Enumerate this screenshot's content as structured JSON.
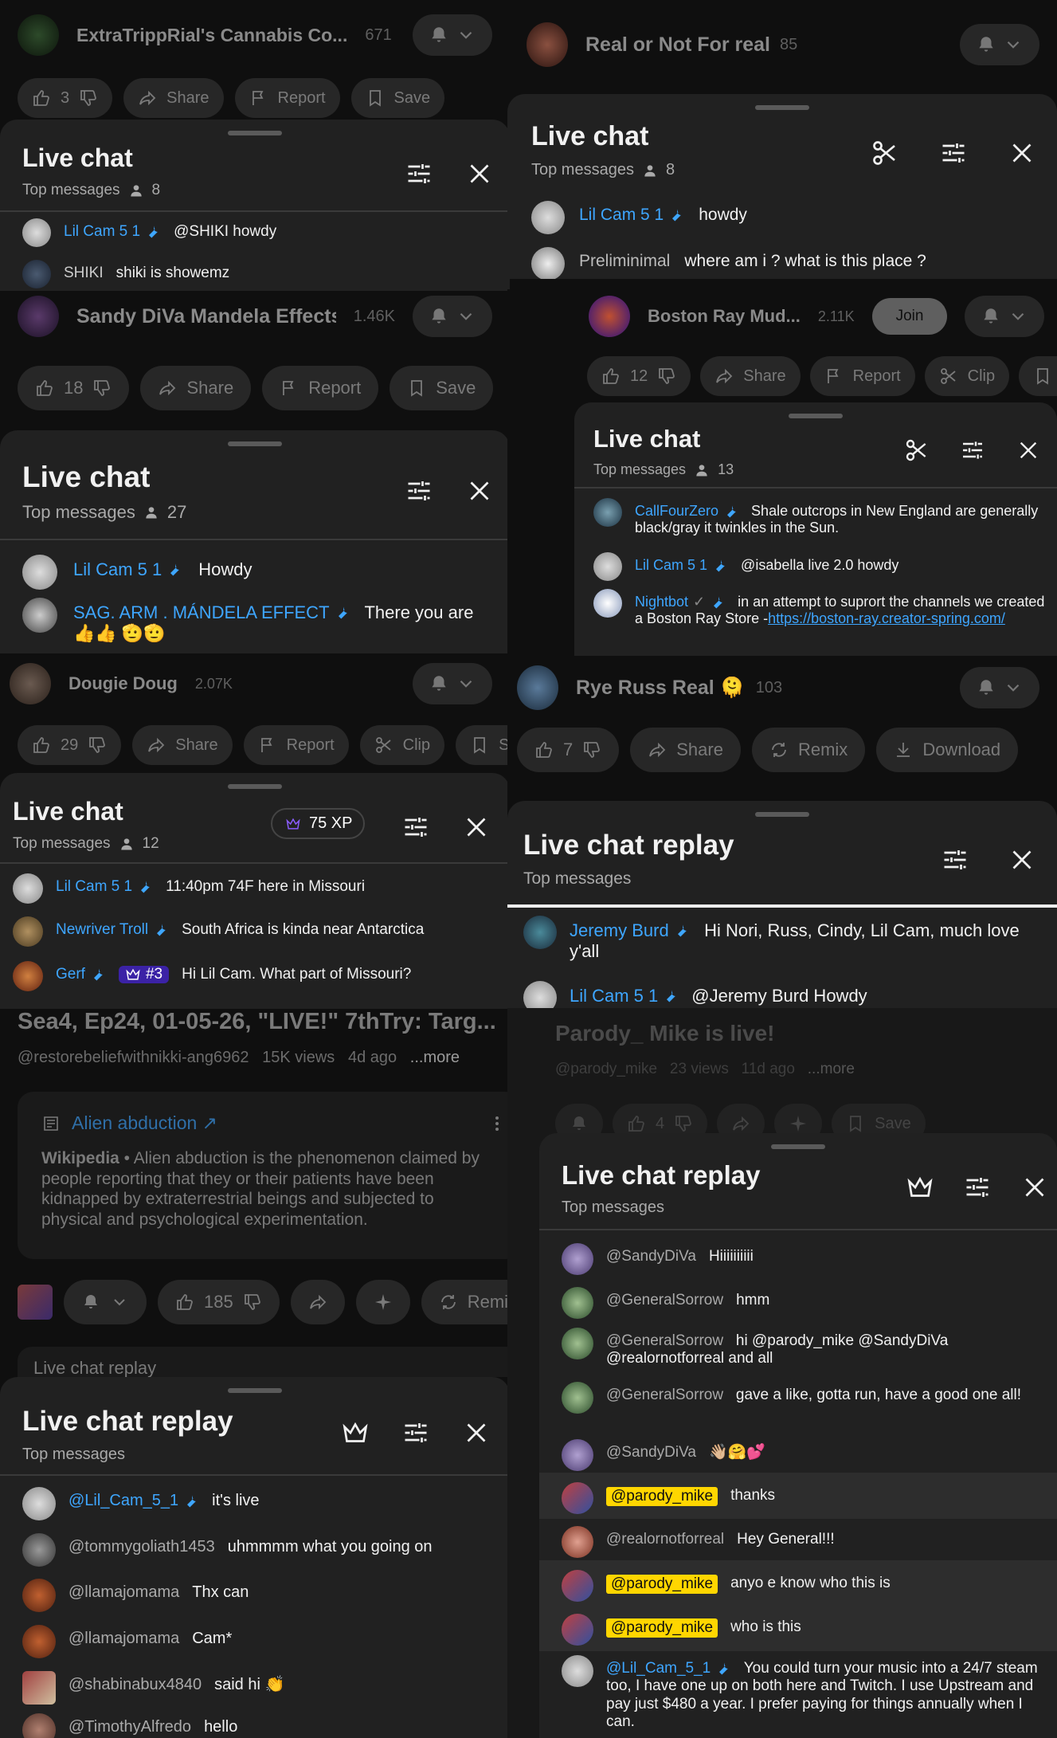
{
  "left": {
    "s1": {
      "channel": "ExtraTrippRial's Cannabis Co...",
      "count": "671",
      "likes": "3",
      "share": "Share",
      "report": "Report",
      "save": "Save",
      "chat": {
        "title": "Live chat",
        "subtitle": "Top messages",
        "viewers": "8",
        "messages": [
          {
            "author": "Lil Cam 5 1",
            "text": "@SHIKI howdy",
            "mod": true
          },
          {
            "author": "SHIKI",
            "text": "shiki is showemz",
            "mod": false
          }
        ]
      }
    },
    "s2": {
      "channel": "Sandy DiVa Mandela Effects",
      "count": "1.46K",
      "likes": "18",
      "share": "Share",
      "report": "Report",
      "save": "Save",
      "chat": {
        "title": "Live chat",
        "subtitle": "Top messages",
        "viewers": "27",
        "messages": [
          {
            "author": "Lil Cam 5 1",
            "text": "Howdy"
          },
          {
            "author": "SAG. ARM . MÁNDELA EFFECT",
            "text": "There you are 👍👍 🫡🫡"
          }
        ]
      }
    },
    "s3": {
      "channel": "Dougie Doug",
      "count": "2.07K",
      "likes": "29",
      "share": "Share",
      "report": "Report",
      "clip": "Clip",
      "save": "Sa",
      "chat": {
        "title": "Live chat",
        "subtitle": "Top messages",
        "viewers": "12",
        "xp": "75 XP",
        "messages": [
          {
            "author": "Lil Cam 5 1",
            "text": "11:40pm 74F here in Missouri"
          },
          {
            "author": "Newriver Troll",
            "text": "South Africa is kinda near Antarctica"
          },
          {
            "author": "Gerf",
            "badge": "#3",
            "text": "Hi Lil Cam. What part of Missouri?"
          }
        ]
      },
      "video_title": "Sea4, Ep24, 01-05-26, \"LIVE!\" 7thTry: Targ...",
      "video_meta": "@restorebeliefwithnikki-ang6962   15K views   4d ago",
      "more": "...more",
      "card": {
        "link": "Alien abduction ↗",
        "source": "Wikipedia",
        "text": " • Alien abduction is the phenomenon claimed by people reporting that they or their patients have been kidnapped by extraterrestrial beings and subjected to physical and psychological experimentation."
      },
      "likes2": "185",
      "remix": "Remix",
      "replay_peek": "Live chat replay"
    },
    "s4": {
      "chat": {
        "title": "Live chat replay",
        "subtitle": "Top messages",
        "messages": [
          {
            "author": "@Lil_Cam_5_1",
            "text": "it's live"
          },
          {
            "author": "@tommygoliath1453",
            "text": "uhmmmm what you going on"
          },
          {
            "author": "@llamajomama",
            "text": "Thx can"
          },
          {
            "author": "@llamajomama",
            "text": "Cam*"
          },
          {
            "author": "@shabinabux4840",
            "text": "said hi 👏"
          },
          {
            "author": "@TimothyAlfredo",
            "text": "hello"
          }
        ]
      }
    }
  },
  "right": {
    "s1": {
      "channel": "Real or Not For real",
      "count": "85",
      "chat": {
        "title": "Live chat",
        "subtitle": "Top messages",
        "viewers": "8",
        "messages": [
          {
            "author": "Lil Cam 5 1",
            "text": "howdy"
          },
          {
            "author": "Preliminimal",
            "text": "where am i ? what is this place ?"
          }
        ]
      }
    },
    "s2": {
      "channel": "Boston Ray Mud...",
      "count": "2.11K",
      "join": "Join",
      "likes": "12",
      "share": "Share",
      "report": "Report",
      "clip": "Clip",
      "save": "Sa",
      "chat": {
        "title": "Live chat",
        "subtitle": "Top messages",
        "viewers": "13",
        "messages": [
          {
            "author": "CallFourZero",
            "text": "Shale outcrops in New England are generally black/gray it twinkles in the Sun."
          },
          {
            "author": "Lil Cam 5 1",
            "text": "@isabella live 2.0 howdy"
          },
          {
            "author": "Nightbot",
            "text": "in an attempt to suprort the channels we created a Boston Ray Store -",
            "link": "https://boston-ray.creator-spring.com/"
          }
        ]
      }
    },
    "s3": {
      "channel": "Rye Russ Real 🫠",
      "count": "103",
      "likes": "7",
      "share": "Share",
      "remix": "Remix",
      "download": "Download",
      "chat": {
        "title": "Live chat replay",
        "subtitle": "Top messages",
        "messages": [
          {
            "author": "Jeremy Burd",
            "text": "Hi Nori, Russ, Cindy, Lil Cam, much love y'all"
          },
          {
            "author": "Lil Cam 5 1",
            "text": "@Jeremy Burd Howdy"
          }
        ]
      }
    },
    "s4": {
      "channel": "Parody_ Mike is live!",
      "meta": "@parody_mike   23 views   11d ago",
      "more": "...more",
      "likes": "4",
      "save": "Save",
      "chat": {
        "title": "Live chat replay",
        "subtitle": "Top messages",
        "messages": [
          {
            "author": "@SandyDiVa",
            "text": "Hiiiiiiiiii"
          },
          {
            "author": "@GeneralSorrow",
            "text": "hmm"
          },
          {
            "author": "@GeneralSorrow",
            "text": "hi @parody_mike @SandyDiVa @realornotforreal and all"
          },
          {
            "author": "@GeneralSorrow",
            "text": "gave a like, gotta run, have a good one all!"
          },
          {
            "author": "@SandyDiVa",
            "text": "👋🏼🤗💕"
          },
          {
            "author": "@parody_mike",
            "text": "thanks",
            "owner": true
          },
          {
            "author": "@realornotforreal",
            "text": "Hey General!!!"
          },
          {
            "author": "@parody_mike",
            "text": "anyo e know who this is",
            "owner": true
          },
          {
            "author": "@parody_mike",
            "text": "who is this",
            "owner": true
          },
          {
            "author": "@Lil_Cam_5_1",
            "text": "You could turn your music into a 24/7 steam too, I have one up on both here and Twitch. I use Upstream and pay just $480 a year. I prefer paying for things annually when I can."
          }
        ]
      }
    }
  }
}
